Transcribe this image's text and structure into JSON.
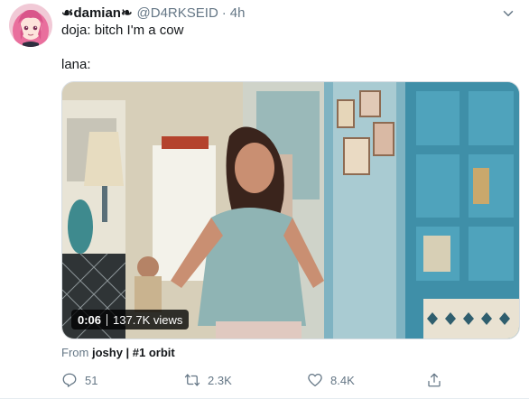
{
  "tweet": {
    "author": {
      "display_name": "࿂damian࿂",
      "display_name_raw": "☙damian❧",
      "handle": "@D4RKSEID",
      "separator": "·",
      "time": "4h",
      "avatar_icon": "anime-avatar"
    },
    "text_line1": "doja: bitch I'm a cow",
    "text_line2": "lana:",
    "media": {
      "type": "video",
      "duration": "0:06",
      "views": "137.7K views"
    },
    "from": {
      "prefix": "From",
      "source": "joshy | #1 orbit"
    },
    "actions": {
      "reply_count": "51",
      "retweet_count": "2.3K",
      "like_count": "8.4K"
    },
    "colors": {
      "text": "#14171a",
      "secondary": "#657786",
      "border": "#e6ecf0"
    }
  }
}
